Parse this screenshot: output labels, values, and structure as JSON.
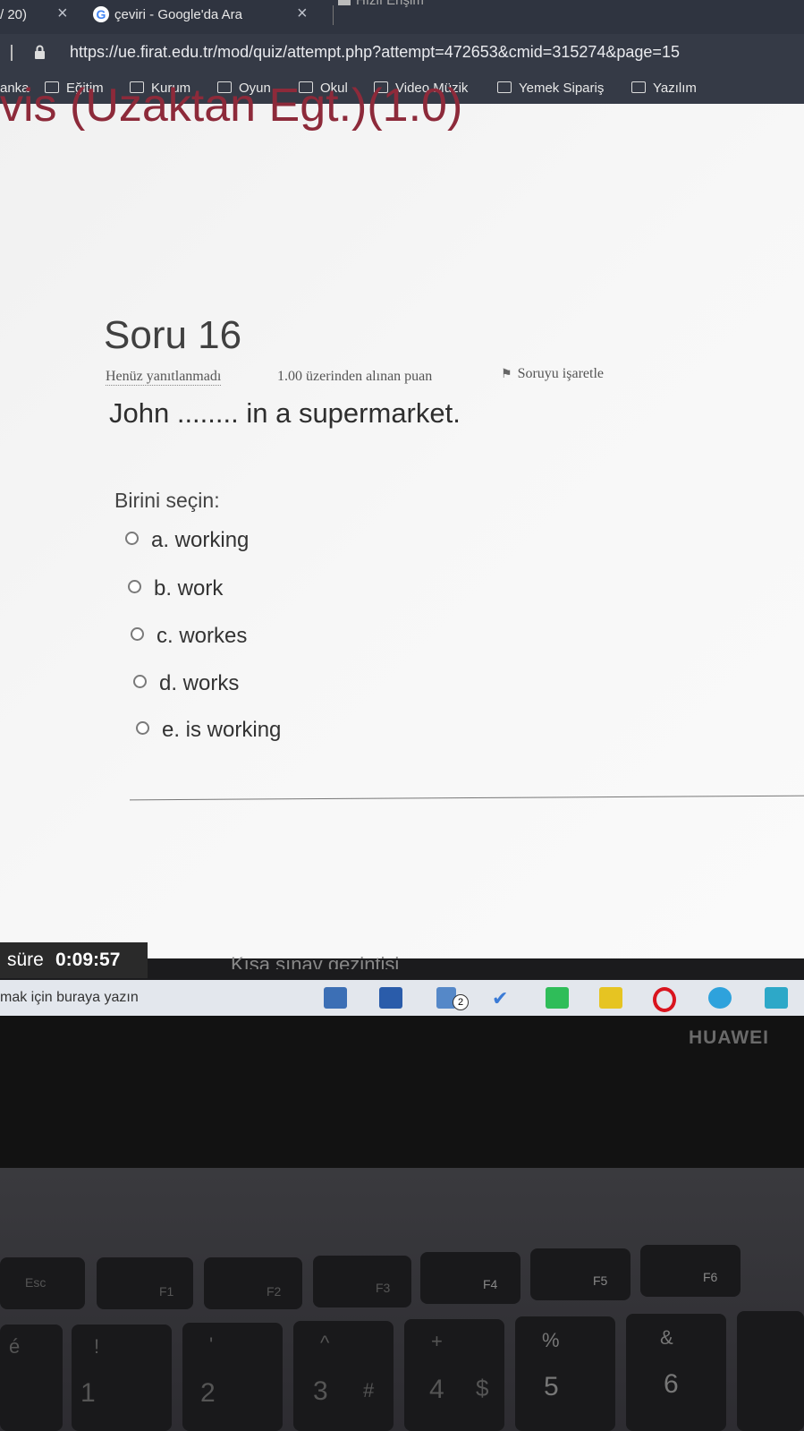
{
  "browser": {
    "tab1_label": "/ 20)",
    "tab2_label": "çeviri - Google'da Ara",
    "tab3_label": "Hızlı Erişim",
    "url": "https://ue.firat.edu.tr/mod/quiz/attempt.php?attempt=472653&cmid=315274&page=15",
    "bookmarks": [
      "anka",
      "Eğitim",
      "Kurum",
      "Oyun",
      "Okul",
      "Video Müzik",
      "Yemek Sipariş",
      "Yazılım"
    ]
  },
  "page": {
    "course_title": "vis (Uzaktan Egt.)(1.0)",
    "question_title": "Soru 16",
    "status": "Henüz yanıtlanmadı",
    "points": "1.00 üzerinden alınan puan",
    "flag_label": "Soruyu işaretle",
    "question_text": "John ........ in a supermarket.",
    "choose_label": "Birini seçin:",
    "options": [
      "a. working",
      "b. work",
      "c. workes",
      "d. works",
      "e. is working"
    ],
    "timer_label": "süre",
    "timer_value": "0:09:57",
    "nav_faded": "Kısa sınav gezintisi"
  },
  "taskbar": {
    "search_placeholder": "mak için buraya yazın",
    "badge_count": "2",
    "icons": [
      "mail-icon",
      "security-icon",
      "files-icon",
      "check-icon",
      "spotify-icon",
      "sticky-icon",
      "opera-icon",
      "telegram-icon",
      "whatsapp-icon"
    ]
  },
  "laptop": {
    "brand": "HUAWEI",
    "fkeys": [
      "Esc",
      "F1",
      "F2",
      "F3",
      "F4",
      "F5",
      "F6"
    ],
    "numkeys": [
      "1",
      "2",
      "3",
      "4",
      "5",
      "6"
    ],
    "numsymbols": [
      "!",
      "'",
      "^",
      "+",
      "%",
      "&"
    ],
    "altsymbols": [
      "é",
      "#",
      "$"
    ]
  },
  "colors": {
    "accent": "#8d2a3a",
    "chrome": "#353a46",
    "taskbar": "#e3e7ed"
  }
}
